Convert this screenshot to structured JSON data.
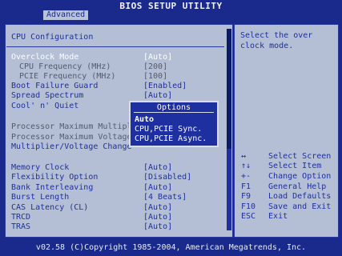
{
  "header": {
    "title": "BIOS SETUP UTILITY",
    "tab": "Advanced"
  },
  "main": {
    "section_title": "CPU Configuration",
    "group1": [
      {
        "label": "Overclock Mode",
        "value": "[Auto]"
      },
      {
        "label": "CPU Frequency (MHz)",
        "value": "[200]"
      },
      {
        "label": "PCIE Frequency (MHz)",
        "value": "[100]"
      },
      {
        "label": "Boot Failure Guard",
        "value": "[Enabled]"
      },
      {
        "label": "Spread Spectrum",
        "value": "[Auto]"
      },
      {
        "label": "Cool' n' Quiet",
        "value": ""
      }
    ],
    "group2": [
      {
        "label": "Processor Maximum Multiplie"
      },
      {
        "label": "Processor Maximum Voltage"
      },
      {
        "label": "Multiplier/Voltage Change"
      }
    ],
    "group3": [
      {
        "label": "Memory Clock",
        "value": "[Auto]"
      },
      {
        "label": "Flexibility Option",
        "value": "[Disabled]"
      },
      {
        "label": "Bank Interleaving",
        "value": "[Auto]"
      },
      {
        "label": "Burst Length",
        "value": "[4 Beats]"
      },
      {
        "label": "CAS Latency (CL)",
        "value": "[Auto]"
      },
      {
        "label": "TRCD",
        "value": "[Auto]"
      },
      {
        "label": "TRAS",
        "value": "[Auto]"
      }
    ]
  },
  "popup": {
    "title": "Options",
    "options": [
      "Auto",
      "CPU,PCIE Sync.",
      "CPU,PCIE Async."
    ],
    "selected": "Auto"
  },
  "help": {
    "text": "Select the over clock mode."
  },
  "keys": [
    {
      "key": "↔",
      "action": "Select Screen"
    },
    {
      "key": "↑↓",
      "action": "Select Item"
    },
    {
      "key": "+-",
      "action": "Change Option"
    },
    {
      "key": "F1",
      "action": "General Help"
    },
    {
      "key": "F9",
      "action": "Load Defaults"
    },
    {
      "key": "F10",
      "action": "Save and Exit"
    },
    {
      "key": "ESC",
      "action": "Exit"
    }
  ],
  "footer": {
    "text": "v02.58 (C)Copyright 1985-2004, American Megatrends, Inc."
  },
  "colors": {
    "background": "#1a2a8c",
    "panel": "#b4bfd5",
    "text_blue": "#1e2fa0",
    "highlight": "#ffffff"
  }
}
